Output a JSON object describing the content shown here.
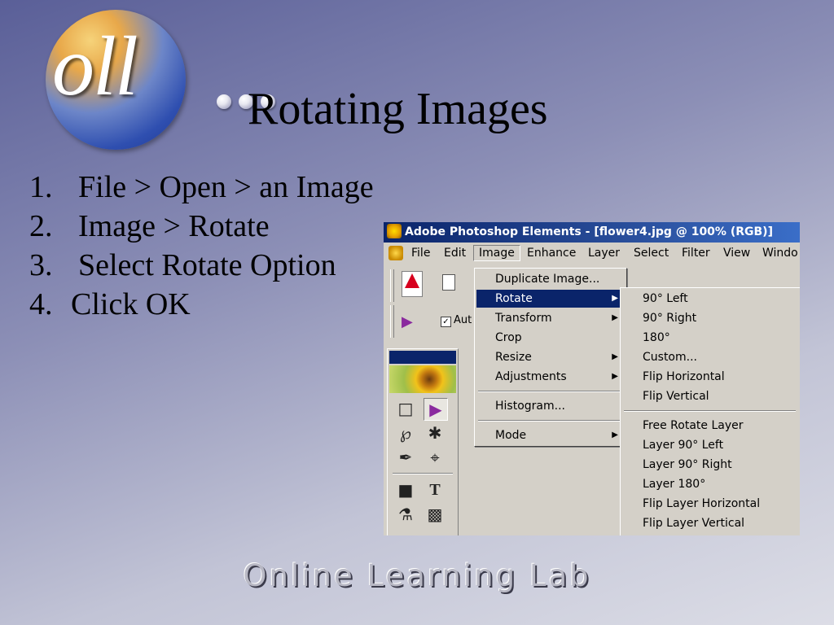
{
  "logo": {
    "text": "oll"
  },
  "slide": {
    "title": "Rotating Images"
  },
  "steps": [
    {
      "num": "1.",
      "text": "File > Open > an Image"
    },
    {
      "num": "2.",
      "text": "Image > Rotate"
    },
    {
      "num": "3.",
      "text": "Select Rotate Option"
    },
    {
      "num": "4.",
      "text": "Click OK"
    }
  ],
  "photoshop": {
    "window_title": "Adobe Photoshop Elements - [flower4.jpg @ 100% (RGB)]",
    "menubar": [
      "File",
      "Edit",
      "Image",
      "Enhance",
      "Layer",
      "Select",
      "Filter",
      "View",
      "Windo"
    ],
    "toolbar": {
      "checkbox_label": "Aut",
      "checkbox_state": "checked"
    },
    "image_menu": [
      {
        "label": "Duplicate Image..."
      },
      {
        "label": "Rotate",
        "has_submenu": true,
        "highlighted": true
      },
      {
        "label": "Transform",
        "has_submenu": true
      },
      {
        "label": "Crop"
      },
      {
        "label": "Resize",
        "has_submenu": true
      },
      {
        "label": "Adjustments",
        "has_submenu": true
      },
      {
        "label": "Histogram..."
      },
      {
        "label": "Mode",
        "has_submenu": true
      }
    ],
    "rotate_submenu": [
      "90° Left",
      "90° Right",
      "180°",
      "Custom...",
      "Flip Horizontal",
      "Flip Vertical",
      "Free Rotate Layer",
      "Layer 90° Left",
      "Layer 90° Right",
      "Layer 180°",
      "Flip Layer Horizontal",
      "Flip Layer Vertical"
    ]
  },
  "footer": {
    "text": "Online Learning Lab"
  },
  "colors": {
    "menu_highlight": "#0a246a",
    "background_top": "#5a5f98",
    "background_bottom": "#dcdde6"
  }
}
